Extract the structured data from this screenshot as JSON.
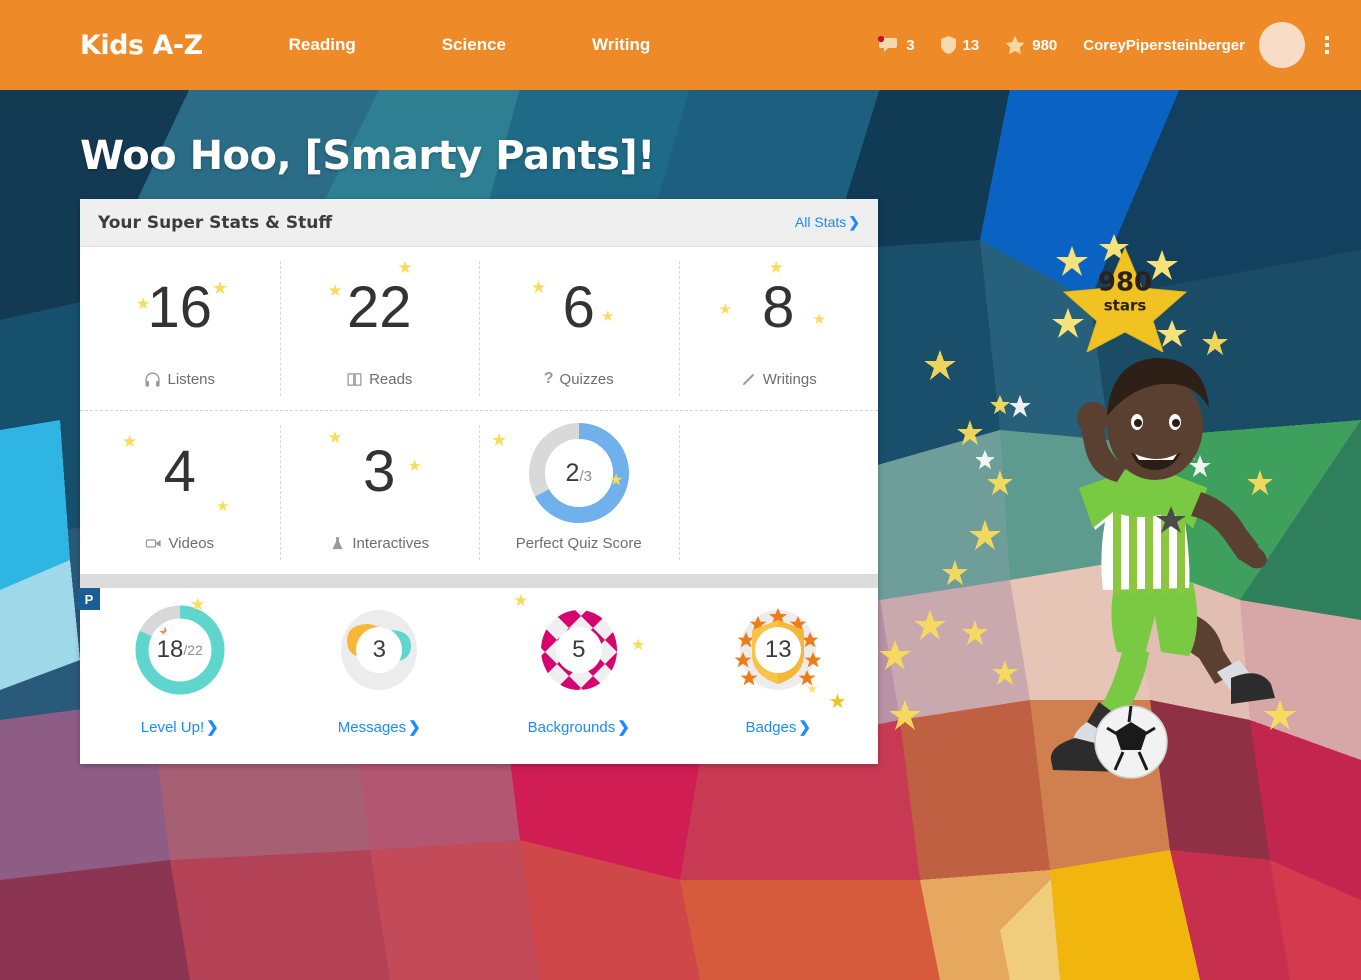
{
  "header": {
    "brand": "Kids A-Z",
    "nav": [
      {
        "label": "Reading",
        "name": "nav-reading"
      },
      {
        "label": "Science",
        "name": "nav-science"
      },
      {
        "label": "Writing",
        "name": "nav-writing"
      }
    ],
    "messages_count": "3",
    "badges_count": "13",
    "stars_count": "980",
    "username": "CoreyPipersteinberger",
    "icons": {
      "messages": "speech-bubble-icon",
      "badges": "shield-icon",
      "stars": "star-icon",
      "avatar": "avatar",
      "menu": "kebab-menu-icon"
    }
  },
  "greeting": "Woo Hoo, [Smarty Pants]!",
  "card": {
    "title": "Your Super Stats & Stuff",
    "all_stats": "All Stats",
    "chevron": "❯",
    "stats_row1": [
      {
        "value": "16",
        "label": "Listens",
        "icon": "headphones-icon"
      },
      {
        "value": "22",
        "label": "Reads",
        "icon": "book-icon"
      },
      {
        "value": "6",
        "label": "Quizzes",
        "icon": "question-mark-icon"
      },
      {
        "value": "8",
        "label": "Writings",
        "icon": "pencil-icon"
      }
    ],
    "stats_row2": [
      {
        "value": "4",
        "label": "Videos",
        "icon": "video-camera-icon"
      },
      {
        "value": "3",
        "label": "Interactives",
        "icon": "flask-icon"
      }
    ],
    "quiz_donut": {
      "numerator": "2",
      "denominator": "/3",
      "label": "Perfect Quiz Score",
      "percent": 67,
      "color": "#70b0ec",
      "track": "#d9d9d9"
    }
  },
  "widgets": [
    {
      "type": "level-up",
      "numerator": "18",
      "denominator": "/22",
      "label": "Level Up!",
      "percent": 82,
      "color": "#5ed6cd",
      "track": "#d8d8d8"
    },
    {
      "type": "messages",
      "value": "3",
      "label": "Messages",
      "color_a": "#f9b535",
      "color_b": "#5ed6cd",
      "dot": "#d32020"
    },
    {
      "type": "backgrounds",
      "value": "5",
      "label": "Backgrounds",
      "color": "#d6046e"
    },
    {
      "type": "badges",
      "value": "13",
      "label": "Badges",
      "color": "#f9c349",
      "star_color": "#ef7c1a"
    }
  ],
  "premium_tab": "P",
  "star_badge": {
    "count": "980",
    "unit": "stars"
  },
  "colors": {
    "brand_orange": "#ee8b28",
    "link_blue": "#1a8cff",
    "star_yellow": "#f9dc5c",
    "card_header": "#efefef"
  }
}
